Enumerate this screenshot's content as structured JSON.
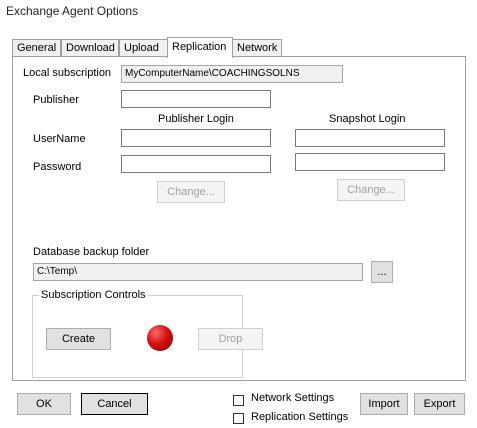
{
  "window": {
    "title": "Exchange Agent Options"
  },
  "tabs": [
    {
      "label": "General"
    },
    {
      "label": "Download"
    },
    {
      "label": "Upload"
    },
    {
      "label": "Replication"
    },
    {
      "label": "Network"
    }
  ],
  "active_tab": "Replication",
  "replication": {
    "local_subscription_label": "Local subscription",
    "local_subscription_value": "MyComputerName\\COACHINGSOLNS",
    "publisher_label": "Publisher",
    "publisher_value": "",
    "publisher_login_header": "Publisher Login",
    "snapshot_login_header": "Snapshot Login",
    "username_label": "UserName",
    "password_label": "Password",
    "publisher_username": "",
    "publisher_password": "",
    "snapshot_username": "",
    "snapshot_password": "",
    "change_label": "Change...",
    "backup_folder_label": "Database backup folder",
    "backup_folder_value": "C:\\Temp\\",
    "browse_label": "...",
    "subscription_controls_label": "Subscription Controls",
    "create_label": "Create",
    "drop_label": "Drop",
    "status_color": "#d41010"
  },
  "footer": {
    "ok_label": "OK",
    "cancel_label": "Cancel",
    "network_settings_label": "Network Settings",
    "replication_settings_label": "Replication Settings",
    "network_settings_checked": false,
    "replication_settings_checked": false,
    "import_label": "Import",
    "export_label": "Export"
  }
}
